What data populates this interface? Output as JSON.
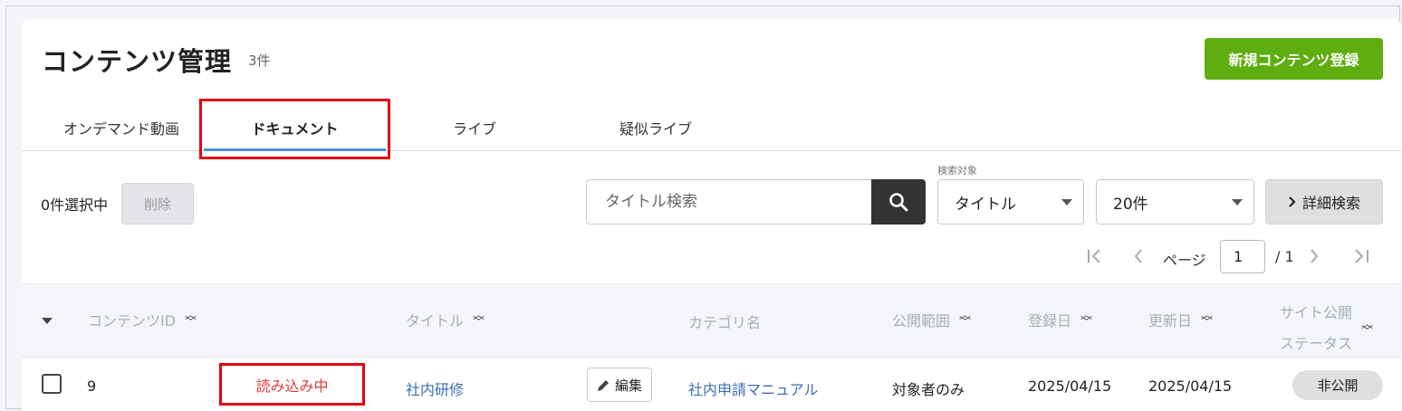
{
  "header": {
    "title": "コンテンツ管理",
    "count": "3件",
    "new_button": "新規コンテンツ登録"
  },
  "tabs": [
    {
      "label": "オンデマンド動画"
    },
    {
      "label": "ドキュメント",
      "active": true
    },
    {
      "label": "ライブ"
    },
    {
      "label": "疑似ライブ"
    }
  ],
  "toolbar": {
    "selected_count": "0件選択中",
    "delete_label": "削除",
    "search_placeholder": "タイトル検索",
    "target_label": "検索対象",
    "target_value": "タイトル",
    "per_page_value": "20件",
    "advanced_label": "詳細検索"
  },
  "pager": {
    "label": "ページ",
    "current": "1",
    "total": "/ 1"
  },
  "table": {
    "columns": {
      "id": "コンテンツID",
      "title": "タイトル",
      "category": "カテゴリ名",
      "scope": "公開範囲",
      "registered": "登録日",
      "updated": "更新日",
      "status_line1": "サイト公開",
      "status_line2": "ステータス"
    },
    "rows": [
      {
        "id": "9",
        "loading": "読み込み中",
        "title": "社内研修",
        "edit": "編集",
        "category": "社内申請マニュアル",
        "scope": "対象者のみ",
        "registered": "2025/04/15",
        "updated": "2025/04/15",
        "status": "非公開"
      }
    ]
  },
  "colors": {
    "accent_green": "#5fae10",
    "highlight_red": "#e60012",
    "link_blue": "#3d6eb4",
    "tab_underline": "#4a90d9"
  }
}
